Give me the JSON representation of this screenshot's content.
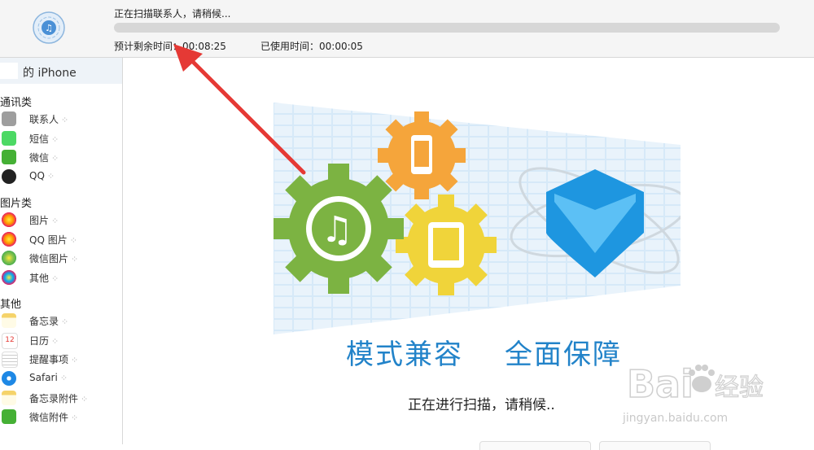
{
  "header": {
    "status": "正在扫描联系人，请稍候...",
    "progress": 0.0,
    "time_remaining_label": "预计剩余时间：",
    "time_remaining_value": "00:08:25",
    "time_used_label": "已使用时间：",
    "time_used_value": "00:00:05"
  },
  "sidebar": {
    "device": "的 iPhone",
    "groups": [
      {
        "title": "通讯类",
        "items": [
          {
            "label": "联系人",
            "icon": "contacts-icon"
          },
          {
            "label": "短信",
            "icon": "messages-icon"
          },
          {
            "label": "微信",
            "icon": "wechat-icon"
          },
          {
            "label": "QQ",
            "icon": "qq-icon"
          }
        ]
      },
      {
        "title": "图片类",
        "items": [
          {
            "label": "图片",
            "icon": "photos-icon"
          },
          {
            "label": "QQ 图片",
            "icon": "qq-photos-icon"
          },
          {
            "label": "微信图片",
            "icon": "wechat-photos-icon"
          },
          {
            "label": "其他",
            "icon": "other-photos-icon"
          }
        ]
      },
      {
        "title": "其他",
        "items": [
          {
            "label": "备忘录",
            "icon": "notes-icon"
          },
          {
            "label": "日历",
            "icon": "calendar-icon"
          },
          {
            "label": "提醒事项",
            "icon": "reminders-icon"
          },
          {
            "label": "Safari",
            "icon": "safari-icon"
          },
          {
            "label": "备忘录附件",
            "icon": "notes-attachment-icon"
          },
          {
            "label": "微信附件",
            "icon": "wechat-attachment-icon"
          }
        ]
      }
    ]
  },
  "main": {
    "slogan_left": "模式兼容",
    "slogan_right": "全面保障",
    "message": "正在进行扫描，请稍候.."
  },
  "watermark": {
    "brand": "Baidu经验",
    "url": "jingyan.baidu.com"
  },
  "colors": {
    "accent": "#2283c9",
    "gear_green": "#7cb342",
    "gear_orange": "#f5a53b",
    "gear_yellow": "#f0d43a",
    "shield_blue": "#1e96e0",
    "arrow_red": "#e53935"
  }
}
